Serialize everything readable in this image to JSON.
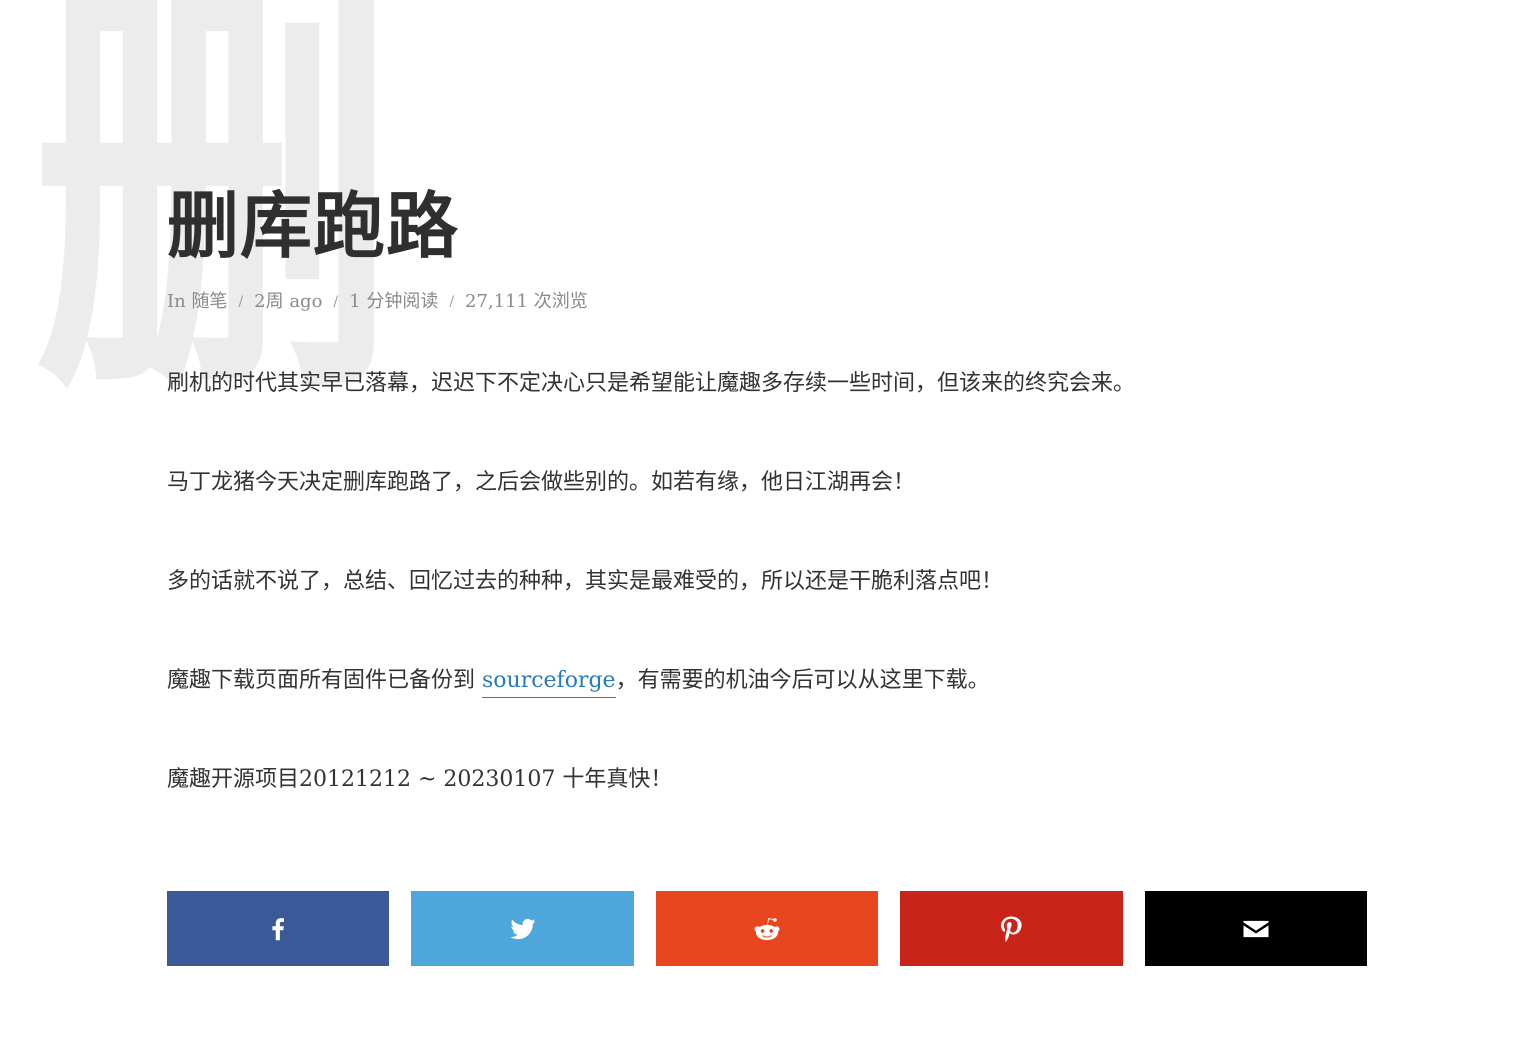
{
  "background_glyph": "删",
  "article": {
    "title": "删库跑路",
    "meta": {
      "in_label": "In",
      "category": "随笔",
      "time": "2周 ago",
      "read_time": "1 分钟阅读",
      "views": "27,111 次浏览",
      "separator": "/"
    },
    "paragraphs": {
      "p1": "刷机的时代其实早已落幕，迟迟下不定决心只是希望能让魔趣多存续一些时间，但该来的终究会来。",
      "p2": "马丁龙猪今天决定删库跑路了，之后会做些别的。如若有缘，他日江湖再会！",
      "p3": "多的话就不说了，总结、回忆过去的种种，其实是最难受的，所以还是干脆利落点吧！",
      "p4_before": "魔趣下载页面所有固件已备份到 ",
      "p4_link": "sourceforge",
      "p4_after": "，有需要的机油今后可以从这里下载。",
      "p5": "魔趣开源项目20121212 ~ 20230107 十年真快！"
    }
  },
  "share": [
    {
      "icon": "facebook-icon",
      "color": "#3b5998"
    },
    {
      "icon": "twitter-icon",
      "color": "#4fa6dc"
    },
    {
      "icon": "reddit-icon",
      "color": "#e8461e"
    },
    {
      "icon": "pinterest-icon",
      "color": "#c92419"
    },
    {
      "icon": "email-icon",
      "color": "#000000"
    }
  ]
}
